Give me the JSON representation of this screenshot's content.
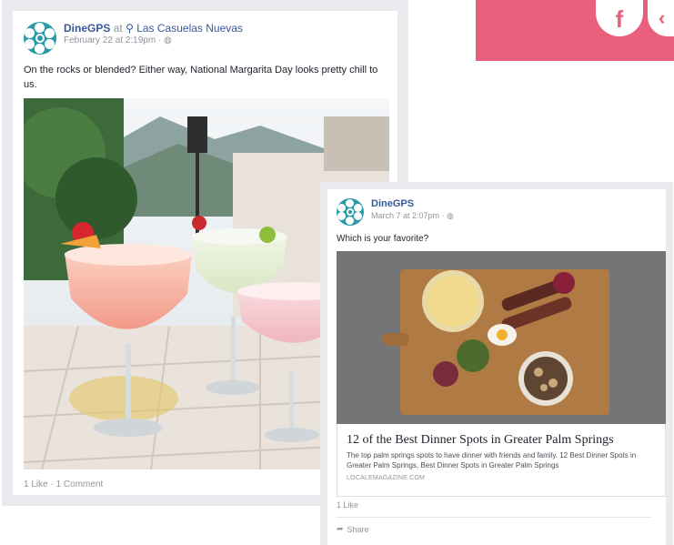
{
  "banner": {
    "icon_letter": "f",
    "color": "#e8607c"
  },
  "post1": {
    "author": "DineGPS",
    "at_word": "at",
    "location": "Las Casuelas Nuevas",
    "timestamp": "February 22 at 2:19pm",
    "text": "On the rocks or blended? Either way, National Margarita Day looks pretty chill to us.",
    "likes": "1 Like",
    "comments": "1 Comment"
  },
  "post2": {
    "author": "DineGPS",
    "timestamp": "March 7 at 2:07pm",
    "text": "Which is your favorite?",
    "link_title": "12 of the Best Dinner Spots in Greater Palm Springs",
    "link_description": "The top palm springs spots to have dinner with friends and family. 12 Best Dinner Spots in Greater Palm Springs, Best Dinner Spots in Greater Palm Springs",
    "link_domain": "LOCALEMAGAZINE.COM",
    "likes": "1 Like",
    "share": "Share"
  }
}
